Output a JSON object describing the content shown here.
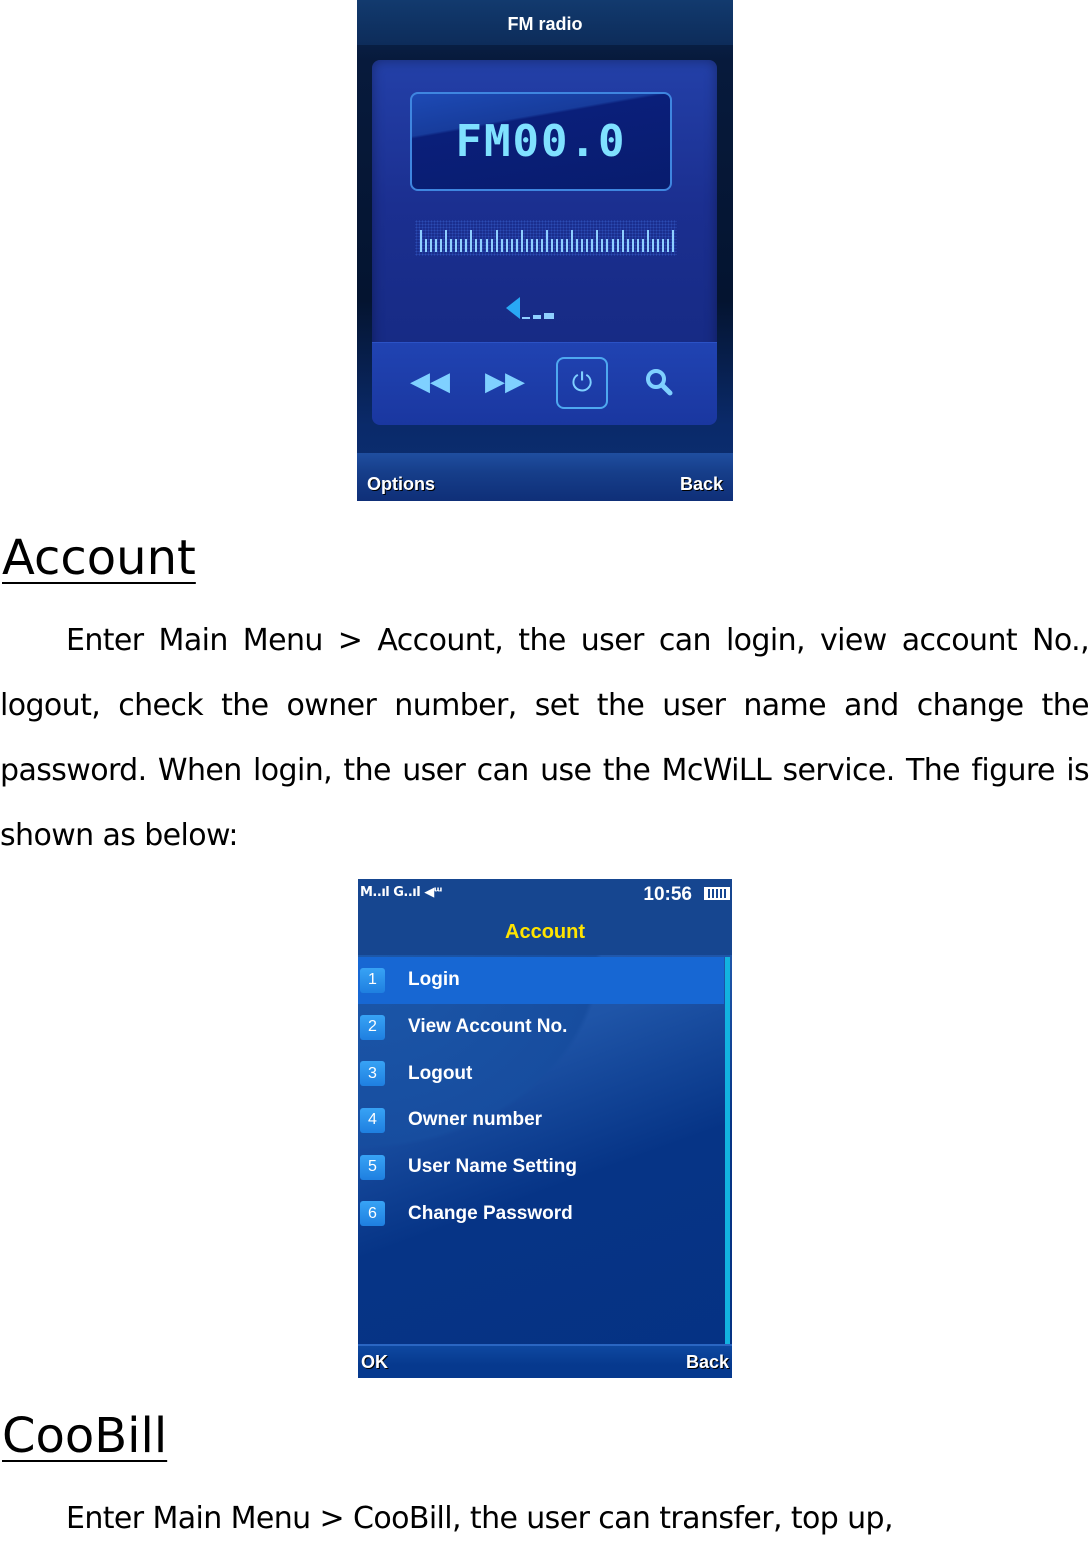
{
  "fm_radio": {
    "title": "FM radio",
    "frequency_display": "FM00.0",
    "volume_level": {
      "filled": 1,
      "total": 3
    },
    "controls": [
      {
        "name": "rewind",
        "icon": "◀◀"
      },
      {
        "name": "fast-forward",
        "icon": "▶▶"
      },
      {
        "name": "power",
        "icon": "⏻"
      },
      {
        "name": "search",
        "icon": "🔍"
      }
    ],
    "softkeys": {
      "left": "Options",
      "right": "Back"
    }
  },
  "account_section": {
    "heading": "Account",
    "paragraph": "Enter Main Menu > Account, the user can login, view account No., logout, check the owner number, set the user name and change the password. When login, the user can use the McWiLL service. The figure is shown as below:"
  },
  "account_screen": {
    "status": {
      "signal_text": "M..ıl G..ıl ◀ᵚ",
      "time": "10:56"
    },
    "title": "Account",
    "menu_items": [
      {
        "number": "1",
        "label": "Login",
        "selected": true
      },
      {
        "number": "2",
        "label": "View Account No.",
        "selected": false
      },
      {
        "number": "3",
        "label": "Logout",
        "selected": false
      },
      {
        "number": "4",
        "label": "Owner number",
        "selected": false
      },
      {
        "number": "5",
        "label": "User Name Setting",
        "selected": false
      },
      {
        "number": "6",
        "label": "Change Password",
        "selected": false
      }
    ],
    "softkeys": {
      "left": "OK",
      "right": "Back"
    }
  },
  "coobill_section": {
    "heading": "CooBill",
    "paragraph": "Enter Main Menu > CooBill, the user can transfer, top up,"
  },
  "colors": {
    "menu_title": "#ffe400",
    "selected_row": "#1767d3",
    "lcd_text": "#7fe1ff"
  }
}
